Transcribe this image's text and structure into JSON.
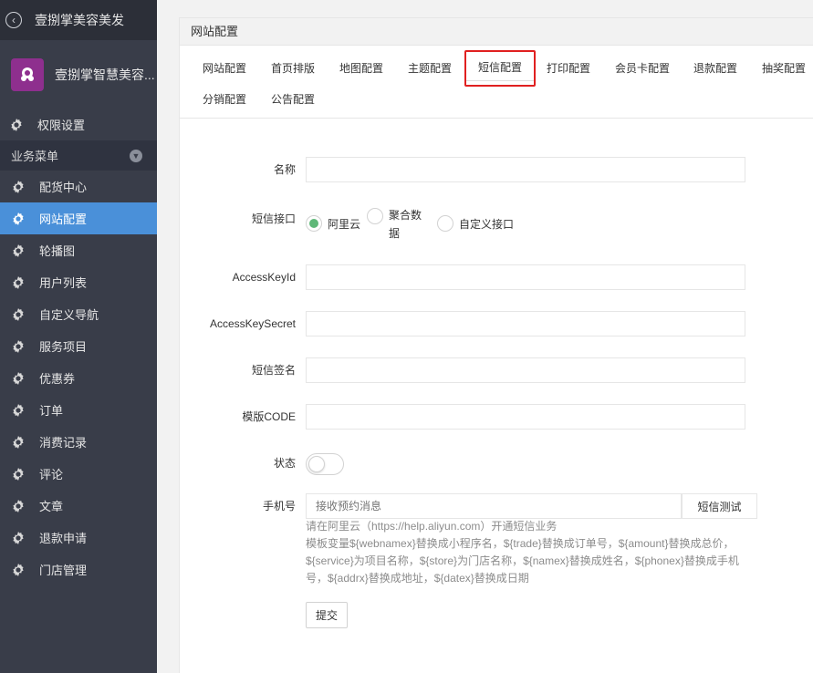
{
  "sidebar": {
    "back_icon": "chevron-left-circle-icon",
    "top_title": "壹捌掌美容美发",
    "store_name": "壹捌掌智慧美容...",
    "store_logo_color": "#8e2f8e",
    "permission_item": "权限设置",
    "group_label": "业务菜单",
    "items": [
      {
        "label": "配货中心",
        "active": false
      },
      {
        "label": "网站配置",
        "active": true
      },
      {
        "label": "轮播图",
        "active": false
      },
      {
        "label": "用户列表",
        "active": false
      },
      {
        "label": "自定义导航",
        "active": false
      },
      {
        "label": "服务项目",
        "active": false
      },
      {
        "label": "优惠券",
        "active": false
      },
      {
        "label": "订单",
        "active": false
      },
      {
        "label": "消费记录",
        "active": false
      },
      {
        "label": "评论",
        "active": false
      },
      {
        "label": "文章",
        "active": false
      },
      {
        "label": "退款申请",
        "active": false
      },
      {
        "label": "门店管理",
        "active": false
      }
    ],
    "active_color": "#4a90d9"
  },
  "panel": {
    "title": "网站配置"
  },
  "tabs": [
    {
      "label": "网站配置"
    },
    {
      "label": "首页排版"
    },
    {
      "label": "地图配置"
    },
    {
      "label": "主题配置"
    },
    {
      "label": "短信配置",
      "active": true
    },
    {
      "label": "打印配置"
    },
    {
      "label": "会员卡配置"
    },
    {
      "label": "退款配置"
    },
    {
      "label": "抽奖配置"
    },
    {
      "label": "分销配置"
    },
    {
      "label": "公告配置"
    }
  ],
  "form": {
    "name_label": "名称",
    "name_value": "",
    "sms_interface_label": "短信接口",
    "sms_options": [
      {
        "label": "阿里云",
        "checked": true
      },
      {
        "label": "聚合数\n据",
        "checked": false
      },
      {
        "label": "自定义接口",
        "checked": false
      }
    ],
    "access_key_id_label": "AccessKeyId",
    "access_key_id_value": "",
    "access_key_secret_label": "AccessKeySecret",
    "access_key_secret_value": "",
    "sign_label": "短信签名",
    "sign_value": "",
    "template_label": "模版CODE",
    "template_value": "",
    "status_label": "状态",
    "status_on": false,
    "phone_label": "手机号",
    "phone_placeholder": "接收预约消息",
    "test_button": "短信测试",
    "help_line1": "请在阿里云（https://help.aliyun.com）开通短信业务",
    "help_line2": "模板变量${webnamex}替换成小程序名，${trade}替换成订单号，${amount}替换成总价，${service}为项目名称，${store}为门店名称，${namex}替换成姓名，${phonex}替换成手机号，${addrx}替换成地址，${datex}替换成日期",
    "submit_button": "提交"
  },
  "colors": {
    "radio_checked": "#5fb878",
    "active_tab_border": "#e02020"
  }
}
